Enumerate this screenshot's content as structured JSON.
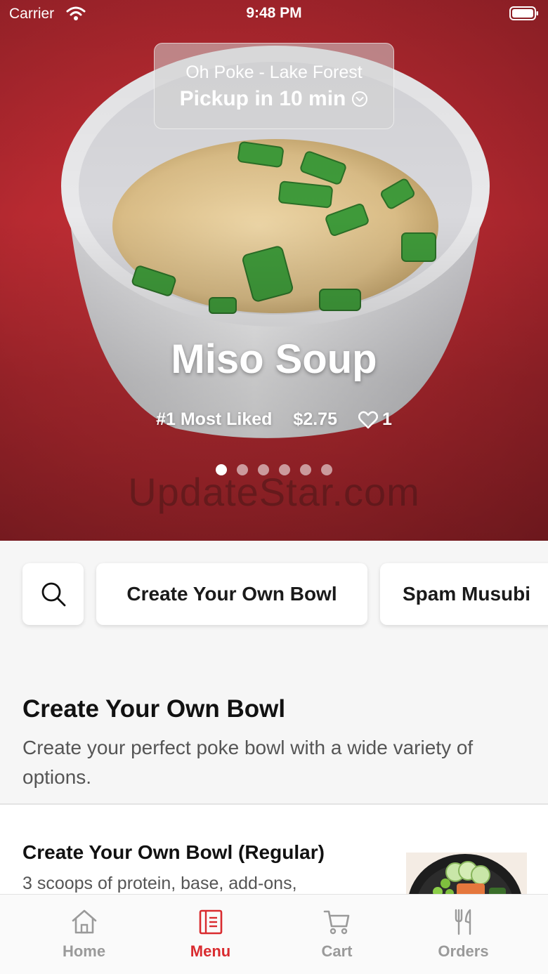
{
  "status_bar": {
    "carrier": "Carrier",
    "time": "9:48 PM"
  },
  "location": {
    "name": "Oh Poke - Lake Forest",
    "pickup": "Pickup in 10 min"
  },
  "featured": {
    "title": "Miso Soup",
    "rank": "#1 Most Liked",
    "price": "$2.75",
    "likes": "1",
    "carousel_total": 6,
    "carousel_active": 1
  },
  "watermark": "UpdateStar.com",
  "categories": [
    {
      "label": "Create Your Own Bowl"
    },
    {
      "label": "Spam Musubi"
    }
  ],
  "section": {
    "title": "Create Your Own Bowl",
    "description": "Create your perfect poke bowl with a wide variety of options."
  },
  "items": [
    {
      "name": "Create Your Own Bowl (Regular)",
      "description": "3 scoops of protein, base, add-ons,"
    }
  ],
  "tabs": [
    {
      "label": "Home",
      "icon": "home-icon"
    },
    {
      "label": "Menu",
      "icon": "menu-icon",
      "active": true
    },
    {
      "label": "Cart",
      "icon": "cart-icon"
    },
    {
      "label": "Orders",
      "icon": "utensils-icon"
    }
  ],
  "colors": {
    "accent": "#d92b2f",
    "hero_bg": "#b82a31",
    "inactive_tab": "#9a9a9a"
  }
}
